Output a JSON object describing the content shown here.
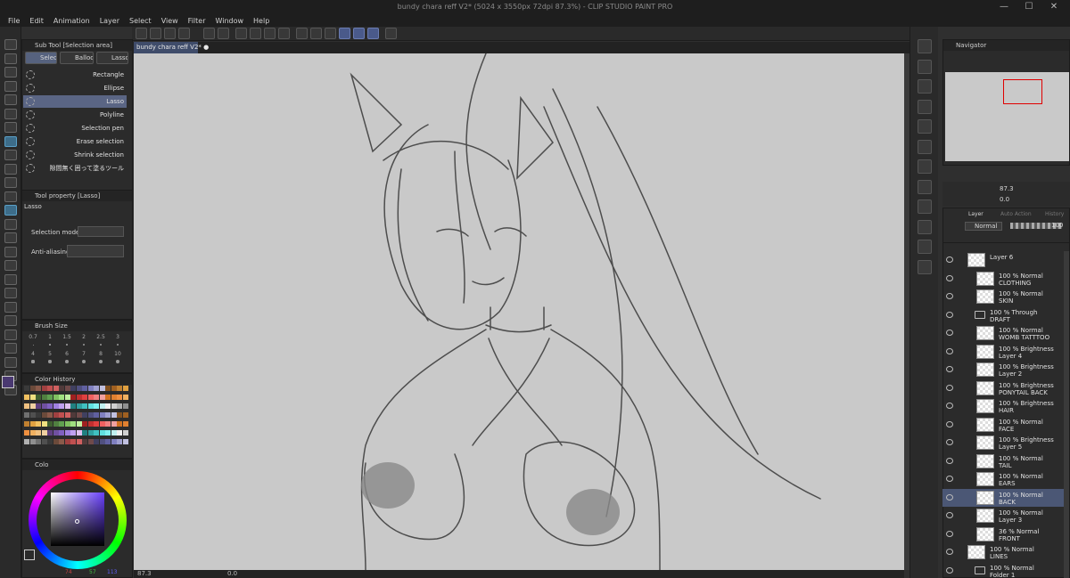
{
  "window": {
    "title": "bundy chara reff V2* (5024 x 3550px 72dpi 87.3%) - CLIP STUDIO PAINT PRO",
    "controls": [
      "—",
      "☐",
      "✕"
    ]
  },
  "menu": [
    "File",
    "Edit",
    "Animation",
    "Layer",
    "Select",
    "View",
    "Filter",
    "Window",
    "Help"
  ],
  "document_tab": {
    "label": "bundy chara reff V2*",
    "close": "●"
  },
  "subtool_panel": {
    "title": "Sub Tool [Selection area]",
    "tabs": [
      "Selecti",
      "Balloon",
      "Lasso fi"
    ],
    "items": [
      "Rectangle",
      "Ellipse",
      "Lasso",
      "Polyline",
      "Selection pen",
      "Erase selection",
      "Shrink selection",
      "隙間無く囲って塗るツール"
    ]
  },
  "tool_property": {
    "title": "Tool property [Lasso]",
    "tool_name": "Lasso",
    "selection_mode_label": "Selection mode",
    "anti_aliasing_label": "Anti-aliasing"
  },
  "brush_size": {
    "title": "Brush Size",
    "sizes": [
      "0.7",
      "1",
      "1.5",
      "2",
      "2.5",
      "3",
      "4",
      "5",
      "6",
      "7",
      "8",
      "10"
    ]
  },
  "color_history": {
    "title": "Color History"
  },
  "color_panel": {
    "title": "Colo",
    "r": "74",
    "g": "57",
    "b": "113",
    "main_color": "#4a3971"
  },
  "status": {
    "zoom": "87.3",
    "angle": "0.0"
  },
  "navigator": {
    "title": "Navigator",
    "zoom": "87.3",
    "rotation": "0.0"
  },
  "layer_panel": {
    "tabs": [
      "Layer",
      "Auto Action",
      "History"
    ],
    "blend_mode": "Normal",
    "opacity": "100",
    "layers": [
      {
        "line1": "",
        "line2": "Layer 6",
        "indent": 0,
        "folder": false,
        "selected": false,
        "visible": true,
        "checker": true
      },
      {
        "line1": "100 % Normal",
        "line2": "CLOTHING",
        "indent": 1,
        "folder": false,
        "selected": false,
        "visible": true,
        "checker": true
      },
      {
        "line1": "100 % Normal",
        "line2": "SKIN",
        "indent": 1,
        "folder": false,
        "selected": false,
        "visible": true,
        "checker": true
      },
      {
        "line1": "100 % Through",
        "line2": "DRAFT",
        "indent": 0,
        "folder": true,
        "selected": false,
        "visible": true,
        "checker": false
      },
      {
        "line1": "100 % Normal",
        "line2": "WOMB TATTTOO",
        "indent": 1,
        "folder": false,
        "selected": false,
        "visible": true,
        "checker": true
      },
      {
        "line1": "100 % Brightness",
        "line2": "Layer 4",
        "indent": 1,
        "folder": false,
        "selected": false,
        "visible": true,
        "checker": true
      },
      {
        "line1": "100 % Brightness",
        "line2": "Layer 2",
        "indent": 1,
        "folder": false,
        "selected": false,
        "visible": true,
        "checker": true
      },
      {
        "line1": "100 % Brightness",
        "line2": "PONYTAIL BACK",
        "indent": 1,
        "folder": false,
        "selected": false,
        "visible": true,
        "checker": true
      },
      {
        "line1": "100 % Brightness",
        "line2": "HAIR",
        "indent": 1,
        "folder": false,
        "selected": false,
        "visible": true,
        "checker": true
      },
      {
        "line1": "100 % Normal",
        "line2": "FACE",
        "indent": 1,
        "folder": false,
        "selected": false,
        "visible": true,
        "checker": true
      },
      {
        "line1": "100 % Brightness",
        "line2": "Layer 5",
        "indent": 1,
        "folder": false,
        "selected": false,
        "visible": true,
        "checker": true
      },
      {
        "line1": "100 % Normal",
        "line2": "TAIL",
        "indent": 1,
        "folder": false,
        "selected": false,
        "visible": true,
        "checker": true
      },
      {
        "line1": "100 % Normal",
        "line2": "EARS",
        "indent": 1,
        "folder": false,
        "selected": false,
        "visible": true,
        "checker": true
      },
      {
        "line1": "100 % Normal",
        "line2": "BACK",
        "indent": 1,
        "folder": false,
        "selected": true,
        "visible": true,
        "checker": true
      },
      {
        "line1": "100 % Normal",
        "line2": "Layer 3",
        "indent": 1,
        "folder": false,
        "selected": false,
        "visible": true,
        "checker": true
      },
      {
        "line1": "36 % Normal",
        "line2": "FRONT",
        "indent": 1,
        "folder": false,
        "selected": false,
        "visible": true,
        "checker": true
      },
      {
        "line1": "100 % Normal",
        "line2": "LINES",
        "indent": 0,
        "folder": false,
        "selected": false,
        "visible": true,
        "checker": true
      },
      {
        "line1": "100 % Normal",
        "line2": "Folder 1",
        "indent": 0,
        "folder": true,
        "selected": false,
        "visible": true,
        "checker": false
      }
    ]
  },
  "colors": {
    "accent": "#5a6584",
    "canvas_bg": "#c9c9c9",
    "line": "#4a4a4a",
    "history_swatches": [
      "#3a3a3a",
      "#6b4a3a",
      "#8a5a4a",
      "#a04040",
      "#c05050",
      "#d06060",
      "#503a3a",
      "#704a4a",
      "#404060",
      "#505080",
      "#6060a0",
      "#8080c0",
      "#a0a0d0",
      "#c0c0e0",
      "#805020",
      "#a06020",
      "#c08030",
      "#e0a040",
      "#f0c060",
      "#f0e080",
      "#406030",
      "#508040",
      "#60a050",
      "#80c060",
      "#a0e080",
      "#c0f0a0",
      "#a02020",
      "#c03030",
      "#e04040",
      "#f06060",
      "#f08080",
      "#f0a0a0",
      "#d07020",
      "#e08030",
      "#f09040",
      "#f0b060",
      "#f0c080",
      "#f0d0a0",
      "#604080",
      "#7050a0",
      "#8060c0",
      "#a080e0",
      "#c0a0f0",
      "#e0c0f0",
      "#208080",
      "#30a0a0",
      "#40c0c0",
      "#60e0e0",
      "#80f0f0",
      "#c0f0f0",
      "#f0f0f0",
      "#d0d0d0",
      "#b0b0b0",
      "#909090",
      "#707070",
      "#505050"
    ]
  }
}
